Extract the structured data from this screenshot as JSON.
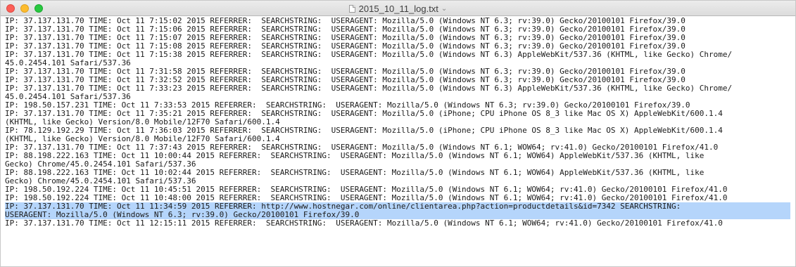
{
  "window": {
    "title": "2015_10_11_log.txt",
    "chevron": "⌄",
    "icons": {
      "close": "close-button",
      "minimize": "minimize-button",
      "maximize": "maximize-button",
      "document": "document-icon"
    }
  },
  "editor": {
    "selection_color": "#b5d5fb",
    "lines": [
      "IP: 37.137.131.70 TIME: Oct 11 7:15:02 2015 REFERRER:  SEARCHSTRING:  USERAGENT: Mozilla/5.0 (Windows NT 6.3; rv:39.0) Gecko/20100101 Firefox/39.0",
      "IP: 37.137.131.70 TIME: Oct 11 7:15:06 2015 REFERRER:  SEARCHSTRING:  USERAGENT: Mozilla/5.0 (Windows NT 6.3; rv:39.0) Gecko/20100101 Firefox/39.0",
      "IP: 37.137.131.70 TIME: Oct 11 7:15:07 2015 REFERRER:  SEARCHSTRING:  USERAGENT: Mozilla/5.0 (Windows NT 6.3; rv:39.0) Gecko/20100101 Firefox/39.0",
      "IP: 37.137.131.70 TIME: Oct 11 7:15:08 2015 REFERRER:  SEARCHSTRING:  USERAGENT: Mozilla/5.0 (Windows NT 6.3; rv:39.0) Gecko/20100101 Firefox/39.0",
      "IP: 37.137.131.70 TIME: Oct 11 7:15:38 2015 REFERRER:  SEARCHSTRING:  USERAGENT: Mozilla/5.0 (Windows NT 6.3) AppleWebKit/537.36 (KHTML, like Gecko) Chrome/",
      "45.0.2454.101 Safari/537.36",
      "IP: 37.137.131.70 TIME: Oct 11 7:31:58 2015 REFERRER:  SEARCHSTRING:  USERAGENT: Mozilla/5.0 (Windows NT 6.3; rv:39.0) Gecko/20100101 Firefox/39.0",
      "IP: 37.137.131.70 TIME: Oct 11 7:32:52 2015 REFERRER:  SEARCHSTRING:  USERAGENT: Mozilla/5.0 (Windows NT 6.3; rv:39.0) Gecko/20100101 Firefox/39.0",
      "IP: 37.137.131.70 TIME: Oct 11 7:33:23 2015 REFERRER:  SEARCHSTRING:  USERAGENT: Mozilla/5.0 (Windows NT 6.3) AppleWebKit/537.36 (KHTML, like Gecko) Chrome/",
      "45.0.2454.101 Safari/537.36",
      "IP: 198.50.157.231 TIME: Oct 11 7:33:53 2015 REFERRER:  SEARCHSTRING:  USERAGENT: Mozilla/5.0 (Windows NT 6.3; rv:39.0) Gecko/20100101 Firefox/39.0",
      "IP: 37.137.131.70 TIME: Oct 11 7:35:21 2015 REFERRER:  SEARCHSTRING:  USERAGENT: Mozilla/5.0 (iPhone; CPU iPhone OS 8_3 like Mac OS X) AppleWebKit/600.1.4",
      "(KHTML, like Gecko) Version/8.0 Mobile/12F70 Safari/600.1.4",
      "IP: 78.129.192.29 TIME: Oct 11 7:36:03 2015 REFERRER:  SEARCHSTRING:  USERAGENT: Mozilla/5.0 (iPhone; CPU iPhone OS 8_3 like Mac OS X) AppleWebKit/600.1.4",
      "(KHTML, like Gecko) Version/8.0 Mobile/12F70 Safari/600.1.4",
      "IP: 37.137.131.70 TIME: Oct 11 7:37:43 2015 REFERRER:  SEARCHSTRING:  USERAGENT: Mozilla/5.0 (Windows NT 6.1; WOW64; rv:41.0) Gecko/20100101 Firefox/41.0",
      "IP: 88.198.222.163 TIME: Oct 11 10:00:44 2015 REFERRER:  SEARCHSTRING:  USERAGENT: Mozilla/5.0 (Windows NT 6.1; WOW64) AppleWebKit/537.36 (KHTML, like",
      "Gecko) Chrome/45.0.2454.101 Safari/537.36",
      "IP: 88.198.222.163 TIME: Oct 11 10:02:44 2015 REFERRER:  SEARCHSTRING:  USERAGENT: Mozilla/5.0 (Windows NT 6.1; WOW64) AppleWebKit/537.36 (KHTML, like",
      "Gecko) Chrome/45.0.2454.101 Safari/537.36",
      "IP: 198.50.192.224 TIME: Oct 11 10:45:51 2015 REFERRER:  SEARCHSTRING:  USERAGENT: Mozilla/5.0 (Windows NT 6.1; WOW64; rv:41.0) Gecko/20100101 Firefox/41.0",
      "IP: 198.50.192.224 TIME: Oct 11 10:48:00 2015 REFERRER:  SEARCHSTRING:  USERAGENT: Mozilla/5.0 (Windows NT 6.1; WOW64; rv:41.0) Gecko/20100101 Firefox/41.0",
      "IP: 37.137.131.70 TIME: Oct 11 11:34:59 2015 REFERRER: http://www.hostnegar.com/online/clientarea.php?action=productdetails&id=7342 SEARCHSTRING:",
      "USERAGENT: Mozilla/5.0 (Windows NT 6.3; rv:39.0) Gecko/20100101 Firefox/39.0",
      "IP: 37.137.131.70 TIME: Oct 11 12:15:11 2015 REFERRER:  SEARCHSTRING:  USERAGENT: Mozilla/5.0 (Windows NT 6.1; WOW64; rv:41.0) Gecko/20100101 Firefox/41.0"
    ]
  }
}
